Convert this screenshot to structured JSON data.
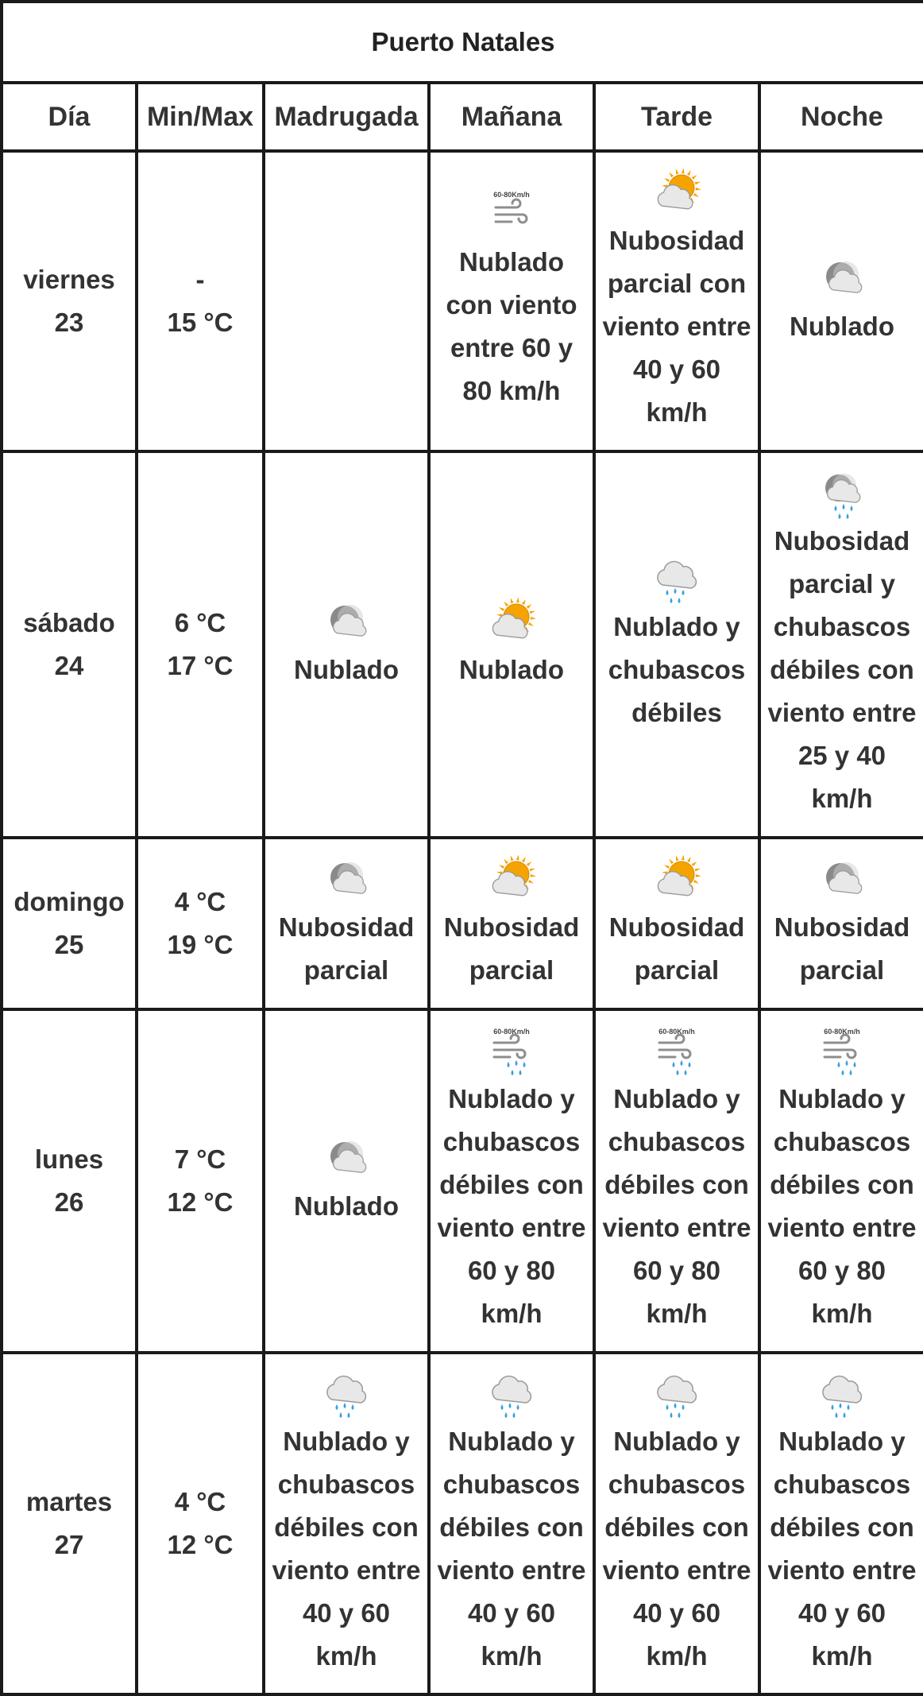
{
  "title": "Puerto Natales",
  "headers": [
    "Día",
    "Min/Max",
    "Madrugada",
    "Mañana",
    "Tarde",
    "Noche"
  ],
  "rows": [
    {
      "day": "viernes",
      "date": "23",
      "min": "-",
      "max": "15 °C",
      "periods": [
        {
          "icon": "",
          "text": ""
        },
        {
          "icon": "wind-strong-icon",
          "text": "Nublado con viento entre 60 y 80 km/h"
        },
        {
          "icon": "sun-cloud-icon",
          "text": "Nubosidad parcial con viento entre 40 y 60 km/h"
        },
        {
          "icon": "moon-cloud-icon",
          "text": "Nublado"
        }
      ]
    },
    {
      "day": "sábado",
      "date": "24",
      "min": "6 °C",
      "max": "17 °C",
      "periods": [
        {
          "icon": "moon-cloud-icon",
          "text": "Nublado"
        },
        {
          "icon": "sun-cloud-icon",
          "text": "Nublado"
        },
        {
          "icon": "cloud-rain-icon",
          "text": "Nublado y chubascos débiles"
        },
        {
          "icon": "moon-cloud-rain-icon",
          "text": "Nubosidad parcial y chubascos débiles con viento entre 25 y 40 km/h"
        }
      ]
    },
    {
      "day": "domingo",
      "date": "25",
      "min": "4 °C",
      "max": "19 °C",
      "periods": [
        {
          "icon": "moon-cloud-icon",
          "text": "Nubosidad parcial"
        },
        {
          "icon": "sun-cloud-icon",
          "text": "Nubosidad parcial"
        },
        {
          "icon": "sun-cloud-icon",
          "text": "Nubosidad parcial"
        },
        {
          "icon": "moon-cloud-icon",
          "text": "Nubosidad parcial"
        }
      ]
    },
    {
      "day": "lunes",
      "date": "26",
      "min": "7 °C",
      "max": "12 °C",
      "periods": [
        {
          "icon": "moon-cloud-icon",
          "text": "Nublado"
        },
        {
          "icon": "wind-rain-icon",
          "text": "Nublado y chubascos débiles con viento entre 60 y 80 km/h"
        },
        {
          "icon": "wind-rain-icon",
          "text": "Nublado y chubascos débiles con viento entre 60 y 80 km/h"
        },
        {
          "icon": "wind-rain-icon",
          "text": "Nublado y chubascos débiles con viento entre 60 y 80 km/h"
        }
      ]
    },
    {
      "day": "martes",
      "date": "27",
      "min": "4 °C",
      "max": "12 °C",
      "periods": [
        {
          "icon": "cloud-rain-icon",
          "text": "Nublado y chubascos débiles con viento entre 40 y 60 km/h"
        },
        {
          "icon": "cloud-rain-icon",
          "text": "Nublado y chubascos débiles con viento entre 40 y 60 km/h"
        },
        {
          "icon": "cloud-rain-icon",
          "text": "Nublado y chubascos débiles con viento entre 40 y 60 km/h"
        },
        {
          "icon": "cloud-rain-icon",
          "text": "Nublado y chubascos débiles con viento entre 40 y 60 km/h"
        }
      ]
    }
  ],
  "icon_labels": {
    "wind": "60-80Km/h"
  },
  "colors": {
    "border": "#1a1a1a",
    "text": "#333333",
    "sun": "#f5a300",
    "cloud": "#e8e8e8",
    "rain": "#3aa0e0"
  }
}
